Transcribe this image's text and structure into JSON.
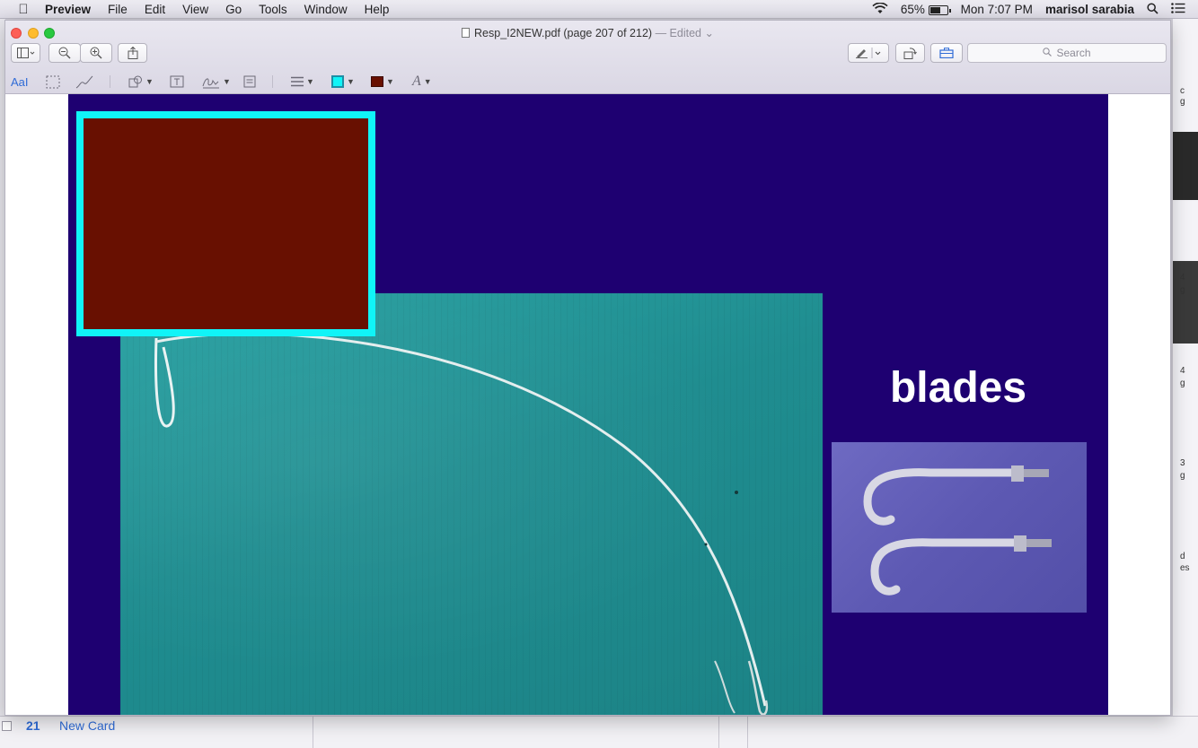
{
  "menubar": {
    "apple_icon": "apple-icon",
    "app_name": "Preview",
    "items": [
      "File",
      "Edit",
      "View",
      "Go",
      "Tools",
      "Window",
      "Help"
    ],
    "battery_percent": "65%",
    "battery_level": 0.65,
    "clock": "Mon 7:07 PM",
    "user": "marisol sarabia"
  },
  "window": {
    "title": "Resp_I2NEW.pdf (page 207 of 212)",
    "title_suffix": "— Edited",
    "search_placeholder": "Search"
  },
  "markup_toolbar": {
    "text_tool_label": "AaI",
    "border_color": "#10f4f7",
    "fill_color": "#681001"
  },
  "slide": {
    "background_color": "#1e0071",
    "caption": "blades",
    "redaction_fill": "#681001",
    "redaction_border": "#10f4f7"
  },
  "background_app": {
    "card_number": "21",
    "card_label": "New Card",
    "right_fragments": [
      "c",
      "g",
      "4",
      "g",
      "4",
      "g",
      "3",
      "g",
      "d",
      "es"
    ]
  }
}
